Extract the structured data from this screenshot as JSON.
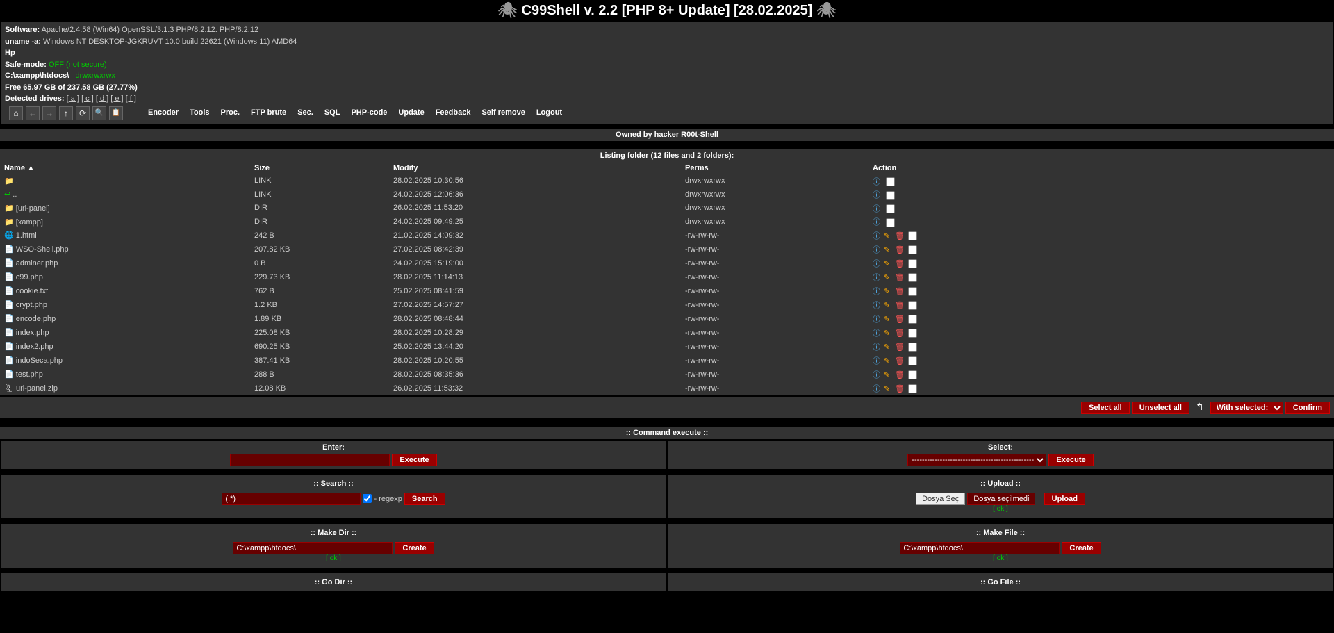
{
  "title": "C99Shell v. 2.2 [PHP 8+ Update] [28.02.2025]",
  "info": {
    "software_label": "Software:",
    "software": "Apache/2.4.58 (Win64) OpenSSL/3.1.3",
    "php_link1": "PHP/8.2.12",
    "php_link2": "PHP/8.2.12",
    "uname_label": "uname -a:",
    "uname": "Windows NT DESKTOP-JGKRUVT 10.0 build 22621 (Windows 11) AMD64",
    "vendor": "Hp",
    "safemode_label": "Safe-mode:",
    "safemode": "OFF (not secure)",
    "cwd": "C:\\xampp\\htdocs\\",
    "cwd_perms": "drwxrwxrwx",
    "disk": "Free 65.97 GB of 237.58 GB (27.77%)",
    "drives_label": "Detected drives:",
    "drives": [
      "a",
      "c",
      "d",
      "e",
      "f"
    ]
  },
  "toolbar": [
    "Encoder",
    "Tools",
    "Proc.",
    "FTP brute",
    "Sec.",
    "SQL",
    "PHP-code",
    "Update",
    "Feedback",
    "Self remove",
    "Logout"
  ],
  "owned": "Owned by hacker R00t-Shell",
  "listing_hdr": "Listing folder (12 files and 2 folders):",
  "cols": {
    "name": "Name ▲",
    "size": "Size",
    "modify": "Modify",
    "perms": "Perms",
    "action": "Action"
  },
  "rows": [
    {
      "icon": "folder",
      "name": ".",
      "size": "LINK",
      "modify": "28.02.2025 10:30:56",
      "perms": "drwxrwxrwx",
      "file": false
    },
    {
      "icon": "back",
      "name": "..",
      "size": "LINK",
      "modify": "24.02.2025 12:06:36",
      "perms": "drwxrwxrwx",
      "file": false
    },
    {
      "icon": "folder",
      "name": "[url-panel]",
      "size": "DIR",
      "modify": "26.02.2025 11:53:20",
      "perms": "drwxrwxrwx",
      "file": false
    },
    {
      "icon": "folder",
      "name": "[xampp]",
      "size": "DIR",
      "modify": "24.02.2025 09:49:25",
      "perms": "drwxrwxrwx",
      "file": false
    },
    {
      "icon": "html",
      "name": "1.html",
      "size": "242 B",
      "modify": "21.02.2025 14:09:32",
      "perms": "-rw-rw-rw-",
      "file": true
    },
    {
      "icon": "php",
      "name": "WSO-Shell.php",
      "size": "207.82 KB",
      "modify": "27.02.2025 08:42:39",
      "perms": "-rw-rw-rw-",
      "file": true
    },
    {
      "icon": "php",
      "name": "adminer.php",
      "size": "0 B",
      "modify": "24.02.2025 15:19:00",
      "perms": "-rw-rw-rw-",
      "file": true
    },
    {
      "icon": "php",
      "name": "c99.php",
      "size": "229.73 KB",
      "modify": "28.02.2025 11:14:13",
      "perms": "-rw-rw-rw-",
      "file": true
    },
    {
      "icon": "txt",
      "name": "cookie.txt",
      "size": "762 B",
      "modify": "25.02.2025 08:41:59",
      "perms": "-rw-rw-rw-",
      "file": true
    },
    {
      "icon": "php",
      "name": "crypt.php",
      "size": "1.2 KB",
      "modify": "27.02.2025 14:57:27",
      "perms": "-rw-rw-rw-",
      "file": true
    },
    {
      "icon": "php",
      "name": "encode.php",
      "size": "1.89 KB",
      "modify": "28.02.2025 08:48:44",
      "perms": "-rw-rw-rw-",
      "file": true
    },
    {
      "icon": "php",
      "name": "index.php",
      "size": "225.08 KB",
      "modify": "28.02.2025 10:28:29",
      "perms": "-rw-rw-rw-",
      "file": true
    },
    {
      "icon": "php",
      "name": "index2.php",
      "size": "690.25 KB",
      "modify": "25.02.2025 13:44:20",
      "perms": "-rw-rw-rw-",
      "file": true
    },
    {
      "icon": "php",
      "name": "indoSeca.php",
      "size": "387.41 KB",
      "modify": "28.02.2025 10:20:55",
      "perms": "-rw-rw-rw-",
      "file": true
    },
    {
      "icon": "php",
      "name": "test.php",
      "size": "288 B",
      "modify": "28.02.2025 08:35:36",
      "perms": "-rw-rw-rw-",
      "file": true
    },
    {
      "icon": "zip",
      "name": "url-panel.zip",
      "size": "12.08 KB",
      "modify": "26.02.2025 11:53:32",
      "perms": "-rw-rw-rw-",
      "file": true
    }
  ],
  "selectors": {
    "select_all": "Select all",
    "unselect_all": "Unselect all",
    "with_selected": "With selected:",
    "confirm": "Confirm"
  },
  "cmd": {
    "header": ":: Command execute ::",
    "enter": "Enter:",
    "select": "Select:",
    "execute": "Execute",
    "select_placeholder": "---------------------------------------------------------------------------------------------------------"
  },
  "search": {
    "header": ":: Search ::",
    "value": "(.*)",
    "regexp": "- regexp",
    "btn": "Search"
  },
  "upload": {
    "header": ":: Upload ::",
    "choose": "Dosya Seç",
    "nofile": "Dosya seçilmedi",
    "btn": "Upload",
    "ok": "[ ok ]"
  },
  "mkdir": {
    "header": ":: Make Dir ::",
    "value": "C:\\xampp\\htdocs\\",
    "btn": "Create",
    "ok": "[ ok ]"
  },
  "mkfile": {
    "header": ":: Make File ::",
    "value": "C:\\xampp\\htdocs\\",
    "btn": "Create",
    "ok": "[ ok ]"
  },
  "godir": {
    "header": ":: Go Dir ::"
  },
  "gofile": {
    "header": ":: Go File ::"
  }
}
